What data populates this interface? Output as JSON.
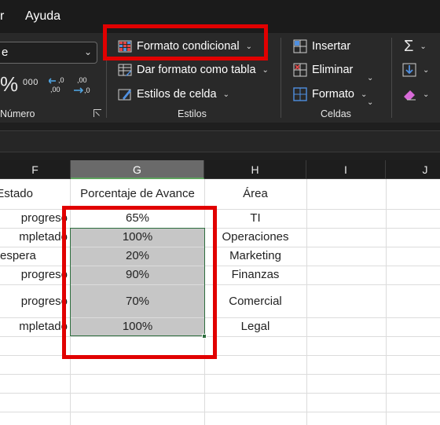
{
  "menu": {
    "partial_item": "r",
    "ayuda": "Ayuda"
  },
  "ribbon": {
    "number_format_value": "e",
    "percent_symbol": "%",
    "thousands_symbol": "000",
    "number_group_label": "Número",
    "styles": {
      "conditional_format": "Formato condicional",
      "format_as_table": "Dar formato como tabla",
      "cell_styles": "Estilos de celda",
      "group_label": "Estilos"
    },
    "cells": {
      "insert": "Insertar",
      "delete": "Eliminar",
      "format": "Formato",
      "group_label": "Celdas"
    },
    "colors": {
      "highlight": "#e10000",
      "accent_green": "#2d6e3e"
    }
  },
  "columns": [
    "F",
    "G",
    "H",
    "I",
    "J"
  ],
  "headers": {
    "estado": "Estado",
    "porcentaje": "Porcentaje de Avance",
    "area": "Área"
  },
  "rows": [
    {
      "estado": "progreso",
      "porcentaje": "65%",
      "area": "TI"
    },
    {
      "estado": "mpletado",
      "porcentaje": "100%",
      "area": "Operaciones"
    },
    {
      "estado": " espera",
      "porcentaje": "20%",
      "area": "Marketing"
    },
    {
      "estado": "progreso",
      "porcentaje": "90%",
      "area": "Finanzas"
    },
    {
      "estado": "progreso",
      "porcentaje": "70%",
      "area": "Comercial"
    },
    {
      "estado": "mpletado",
      "porcentaje": "100%",
      "area": "Legal"
    }
  ]
}
